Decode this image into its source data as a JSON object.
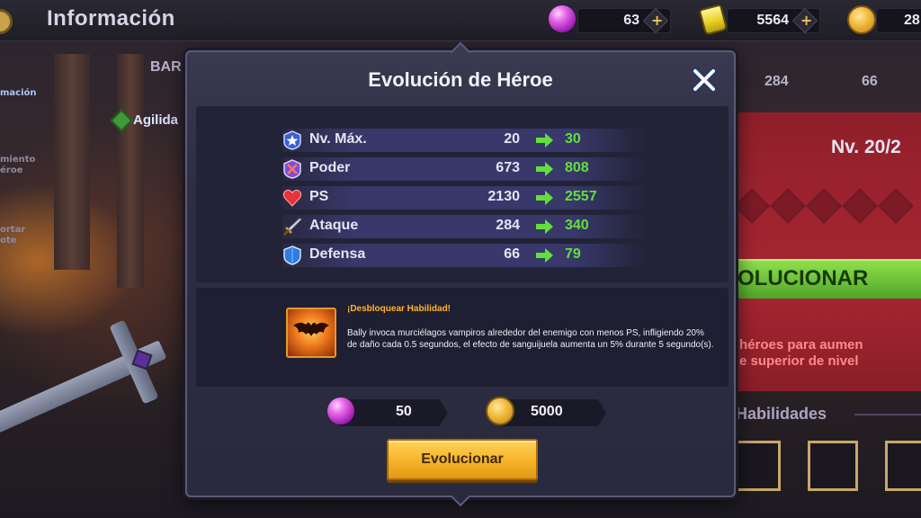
{
  "topbar": {
    "title": "Información",
    "resources": [
      {
        "icon": "gem-icon",
        "value": "63"
      },
      {
        "icon": "elixir-icon",
        "value": "5564"
      },
      {
        "icon": "coin-icon",
        "value": "28"
      }
    ]
  },
  "background": {
    "left_tabs": [
      "mación",
      "miento",
      "éroe",
      "ortar",
      "ote"
    ],
    "bar_label": "BAR",
    "agility_label": "Agilida",
    "top_stats": [
      "284",
      "66"
    ],
    "level_label": "Nv. 20/2",
    "evolve_label": "OLUCIONAR",
    "hint_line1": "héroes para aumen",
    "hint_line2": "e superior de nivel",
    "skills_label": "Habilidades"
  },
  "modal": {
    "title": "Evolución de Héroe",
    "stats": [
      {
        "icon": "star-badge-icon",
        "label": "Nv. Máx.",
        "old": "20",
        "new": "30"
      },
      {
        "icon": "power-shield-icon",
        "label": "Poder",
        "old": "673",
        "new": "808"
      },
      {
        "icon": "heart-icon",
        "label": "PS",
        "old": "2130",
        "new": "2557"
      },
      {
        "icon": "sword-icon",
        "label": "Ataque",
        "old": "284",
        "new": "340"
      },
      {
        "icon": "shield-icon",
        "label": "Defensa",
        "old": "66",
        "new": "79"
      }
    ],
    "skill": {
      "icon": "bat-skill-icon",
      "unlock_label": "¡Desbloquear Habilidad!",
      "description": "Bally invoca murciélagos vampiros alrededor del enemigo con menos PS, infligiendo 20% de daño cada 0.5 segundos, el efecto de sanguijuela aumenta un 5% durante 5 segundo(s)."
    },
    "costs": [
      {
        "icon": "gem-icon",
        "value": "50"
      },
      {
        "icon": "coin-icon",
        "value": "5000"
      }
    ],
    "evolve_button": "Evolucionar"
  },
  "colors": {
    "accent_gold": "#f7b52b",
    "stat_new_green": "#62e03a",
    "unlock_orange": "#ffb52a",
    "modal_bg": "#2e2d42"
  }
}
